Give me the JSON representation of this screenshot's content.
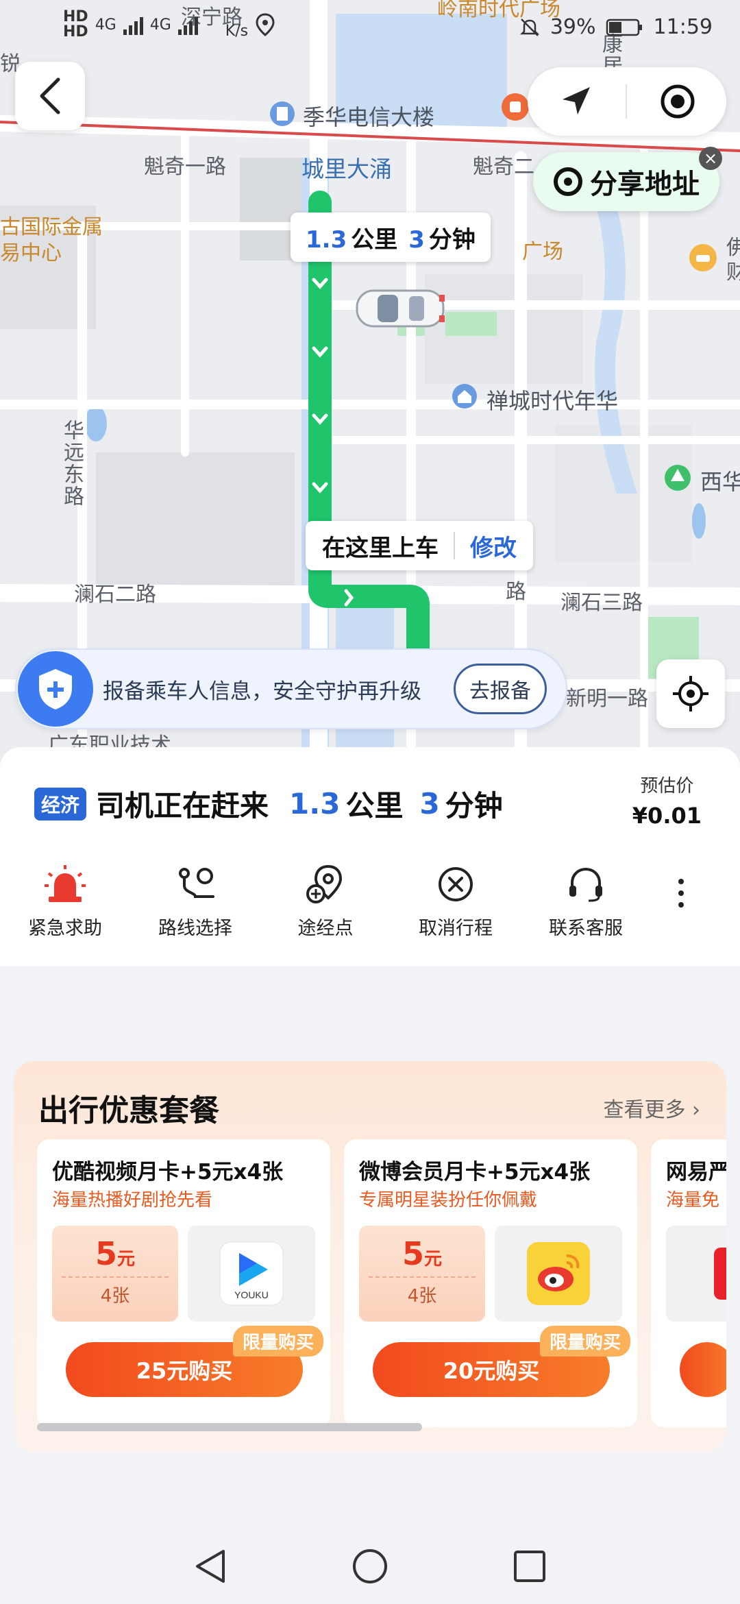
{
  "status_bar": {
    "net1": "HD",
    "net2": "HD",
    "sig1": "4G",
    "sig2": "4G",
    "speed": "K/s",
    "battery": "39%",
    "time": "11:59"
  },
  "map": {
    "labels": {
      "shenning_road": "深宁路",
      "lingnan_plaza": "岭南时代广场",
      "kangju_street": "康居街",
      "jihua_building": "季华电信大楼",
      "kuiqi_road_1": "魁奇一路",
      "chengli_canal": "城里大涌",
      "kuiqi_road_2": "魁奇二",
      "intl_metals_1": "古国际金属",
      "intl_metals_2": "易中心",
      "plaza_right": "广场",
      "chancheng_plaza": "禅城时代年华",
      "huayuan_road": "华远东路",
      "xihua": "西华",
      "lanshi_road_2": "澜石二路",
      "lanshi_road_3": "澜石三路",
      "road_vertical": "路",
      "xinming_road": "新明一路",
      "guangdong_college": "广东职业技术",
      "edge_left": "锐",
      "edge_right_1": "佛",
      "edge_right_2": "财"
    },
    "eta_bubble": {
      "distance": "1.3",
      "distance_unit": "公里",
      "minutes": "3",
      "minutes_unit": "分钟"
    },
    "pickup": {
      "label": "在这里上车",
      "edit": "修改"
    },
    "share_address": "分享地址",
    "route_color": "#1fc46b"
  },
  "report_banner": {
    "text": "报备乘车人信息，安全守护再升级",
    "button": "去报备"
  },
  "trip": {
    "tag": "经济",
    "status": "司机正在赶来",
    "distance": "1.3",
    "distance_unit": "公里",
    "minutes": "3",
    "minutes_unit": "分钟",
    "price_label": "预估价",
    "price": "¥0.01",
    "actions": [
      {
        "label": "紧急求助",
        "icon": "alarm-icon"
      },
      {
        "label": "路线选择",
        "icon": "route-icon"
      },
      {
        "label": "途经点",
        "icon": "waypoint-icon"
      },
      {
        "label": "取消行程",
        "icon": "cancel-icon"
      },
      {
        "label": "联系客服",
        "icon": "headset-icon"
      }
    ]
  },
  "promo": {
    "title": "出行优惠套餐",
    "more": "查看更多",
    "cards": [
      {
        "title": "优酷视频月卡+5元x4张",
        "subtitle": "海量热播好剧抢先看",
        "coupon_amount": "5",
        "coupon_unit": "元",
        "coupon_count": "4张",
        "brand": "YOUKU",
        "buy": "25元购买",
        "limit": "限量购买"
      },
      {
        "title": "微博会员月卡+5元x4张",
        "subtitle": "专属明星装扮任你佩戴",
        "coupon_amount": "5",
        "coupon_unit": "元",
        "coupon_count": "4张",
        "brand": "weibo",
        "buy": "20元购买",
        "limit": "限量购买"
      },
      {
        "title": "网易严",
        "subtitle": "海量免"
      }
    ]
  },
  "colors": {
    "accent_blue": "#2a68d8",
    "route_green": "#1fc46b",
    "buy_orange": "#f24a1e"
  }
}
